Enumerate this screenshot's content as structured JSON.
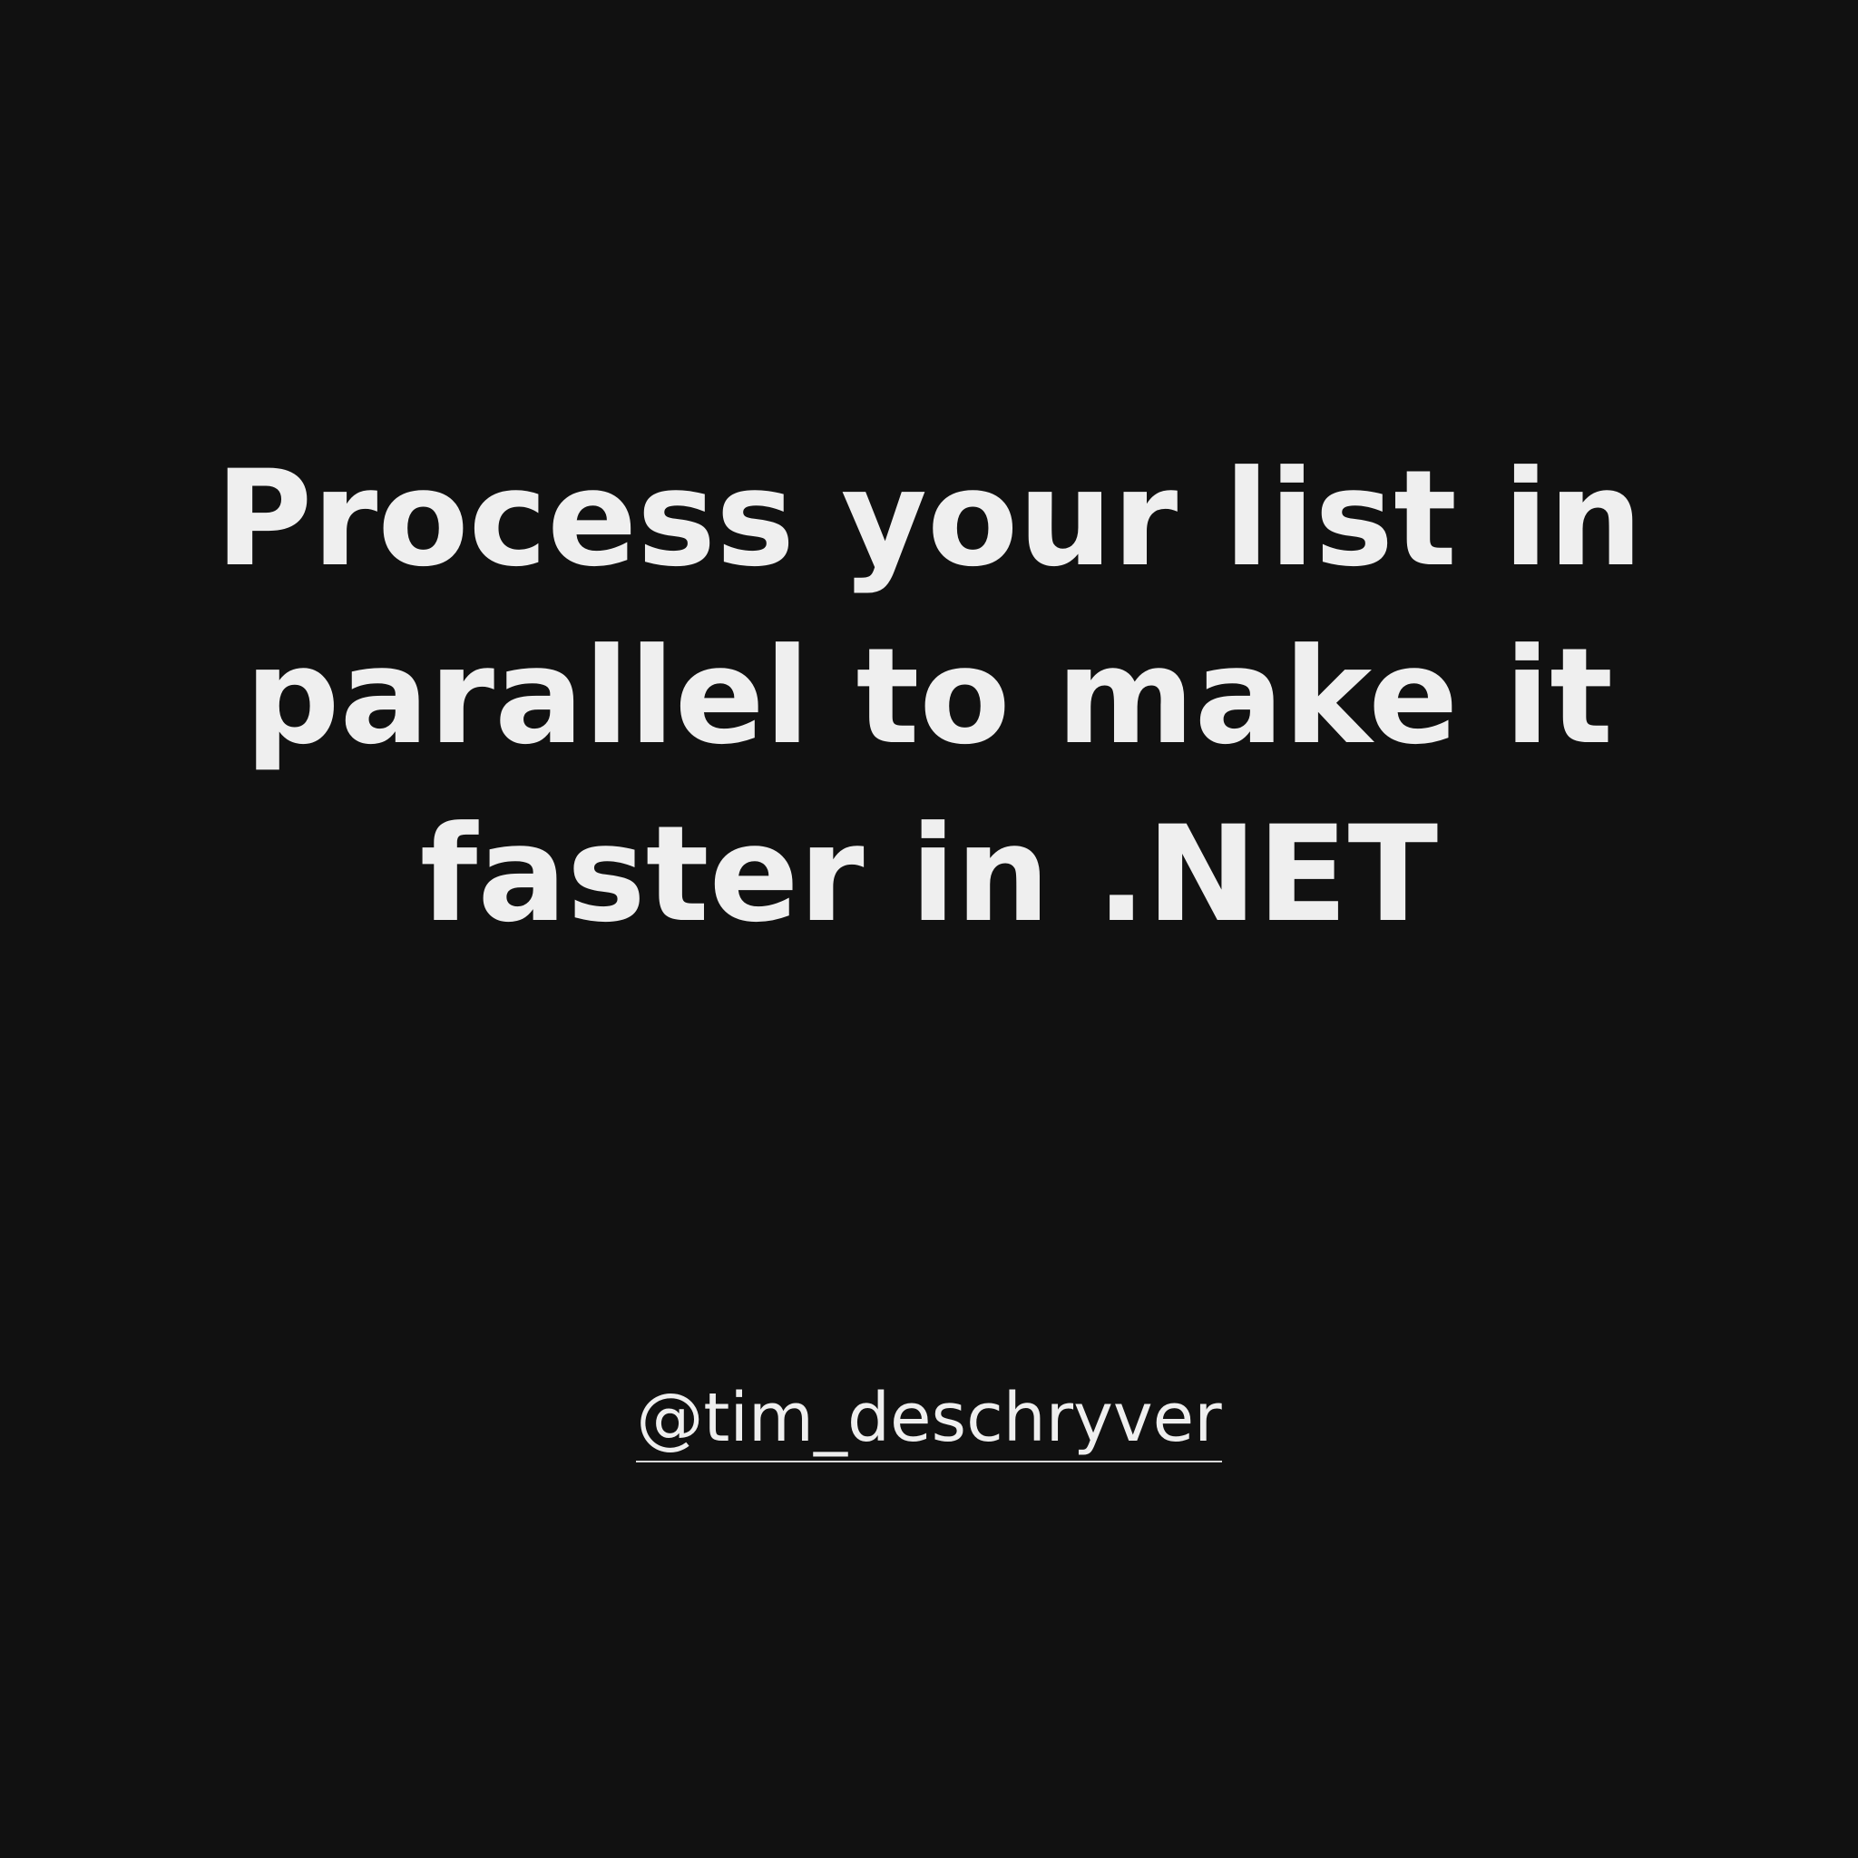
{
  "colors": {
    "background": "#111111",
    "text": "#efefef"
  },
  "post": {
    "title_lines": [
      "Process your list in",
      "parallel to make it",
      "faster in .NET"
    ],
    "author_handle": "@tim_deschryver"
  }
}
